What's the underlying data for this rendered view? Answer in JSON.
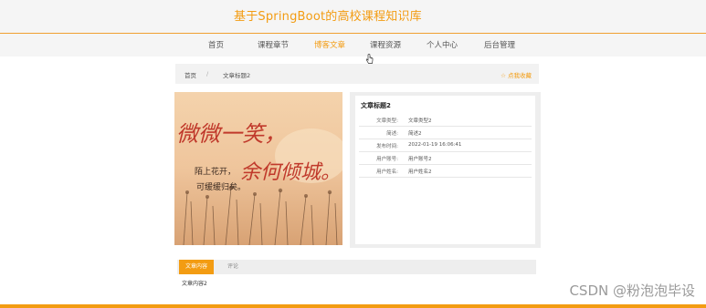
{
  "header": {
    "site_title": "基于SpringBoot的高校课程知识库"
  },
  "nav": {
    "items": [
      {
        "label": "首页"
      },
      {
        "label": "课程章节"
      },
      {
        "label": "博客文章",
        "active": true
      },
      {
        "label": "课程资源"
      },
      {
        "label": "个人中心"
      },
      {
        "label": "后台管理"
      }
    ]
  },
  "breadcrumb": {
    "home": "首页",
    "separator": "/",
    "current": "文章标题2",
    "favorite": "☆ 点我收藏"
  },
  "cover": {
    "image_text": {
      "line1": "微微一笑，",
      "line2": "陌上花开，",
      "line3": "余何倾城。",
      "line4": "可缓缓归矣。"
    }
  },
  "article": {
    "title": "文章标题2",
    "fields": [
      {
        "label": "文章类型:",
        "value": "文章类型2"
      },
      {
        "label": "简述:",
        "value": "简述2"
      },
      {
        "label": "发布时间:",
        "value": "2022-01-19 16:06:41"
      },
      {
        "label": "用户账号:",
        "value": "用户账号2"
      },
      {
        "label": "用户姓名:",
        "value": "用户姓名2"
      }
    ]
  },
  "tabs": {
    "items": [
      {
        "label": "文章内容",
        "active": true
      },
      {
        "label": "评论"
      }
    ]
  },
  "content": {
    "text": "文章内容2"
  },
  "watermark": "CSDN @粉泡泡毕设",
  "colors": {
    "accent": "#f39c12",
    "nav_bg": "#f5f5f5"
  }
}
